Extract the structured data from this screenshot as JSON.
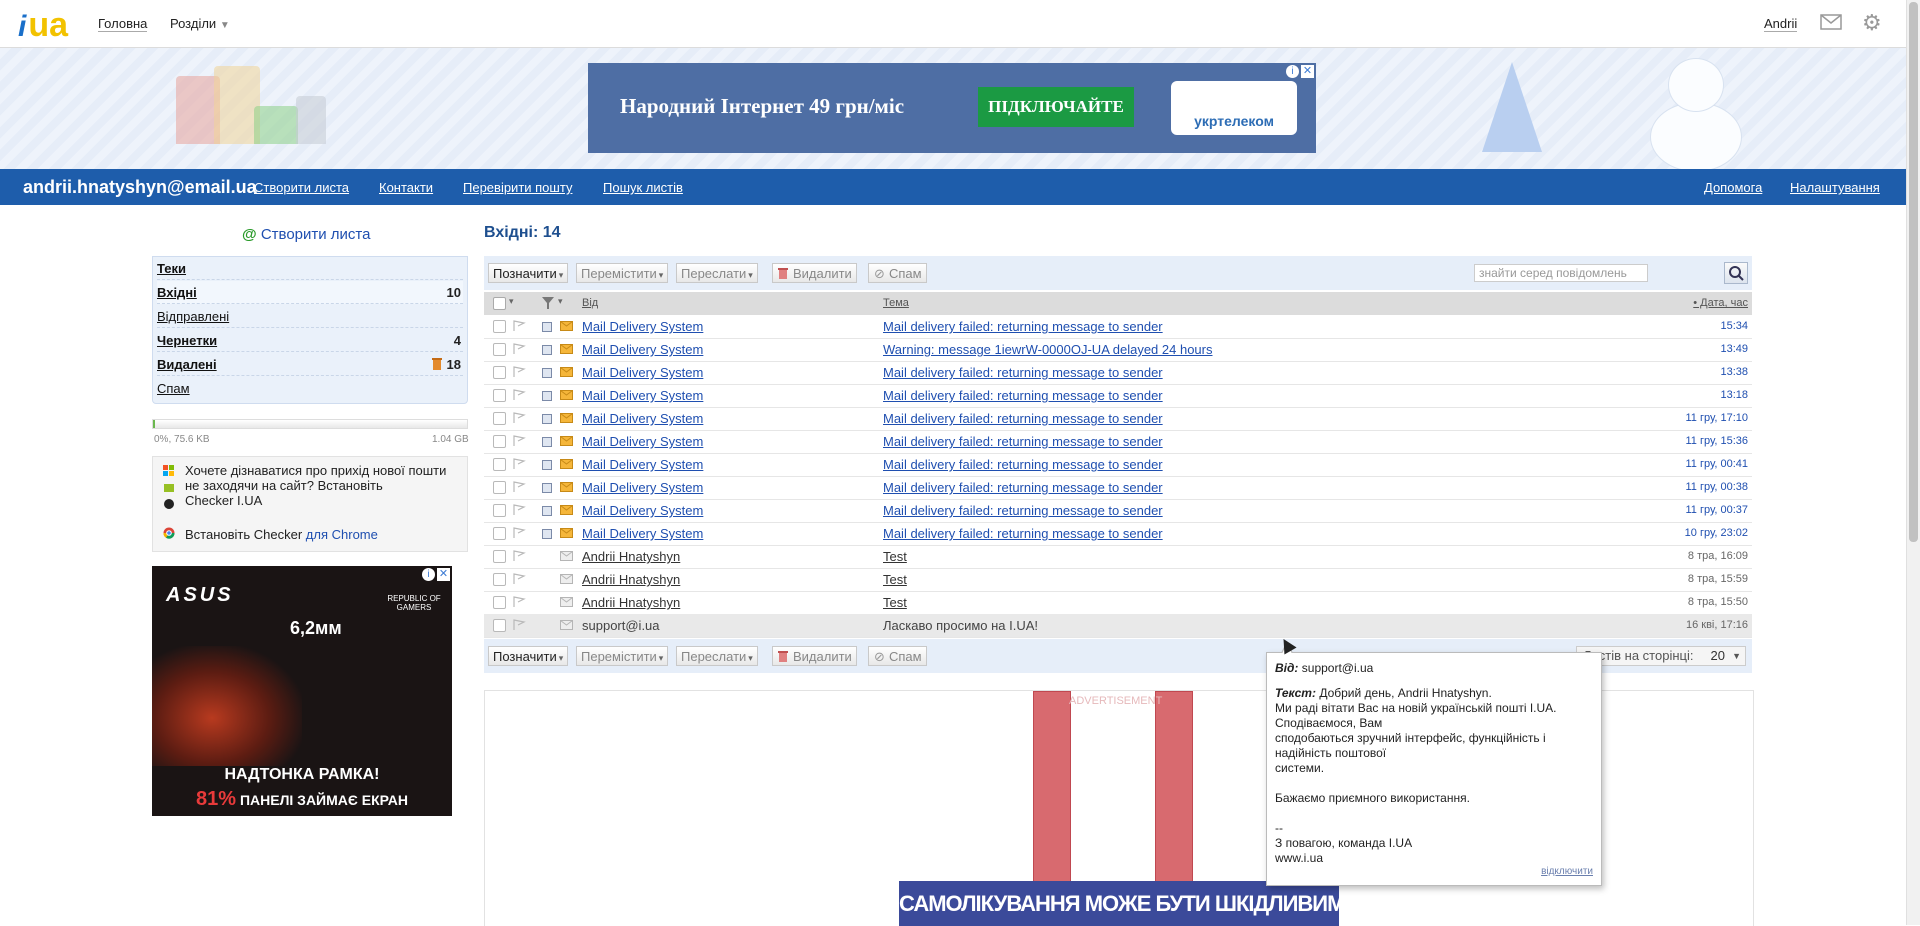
{
  "top": {
    "logo_i": "i",
    "logo_ua": "ua",
    "nav_home": "Головна",
    "nav_sections": "Розділи",
    "caret": "▼",
    "user": "Andrii"
  },
  "banner_ad": {
    "text": "Народний Інтернет 49 грн/міс",
    "button": "ПІДКЛЮЧАЙТЕ",
    "brand": "укртелеком",
    "close": "✕",
    "info": "i"
  },
  "bluebar": {
    "email": "andrii.hnatyshyn@email.ua",
    "links": [
      "Створити листа",
      "Контакти",
      "Перевірити пошту",
      "Пошук листів"
    ],
    "help": "Допомога",
    "settings": "Налаштування"
  },
  "sidebar": {
    "create_at": "@",
    "create_label": "Створити листа",
    "folders": [
      {
        "label": "Теки",
        "count": ""
      },
      {
        "label": "Вхідні",
        "count": "10"
      },
      {
        "label": "Відправлені",
        "count": ""
      },
      {
        "label": "Чернетки",
        "count": "4"
      },
      {
        "label": "Видалені",
        "count": "18"
      },
      {
        "label": "Спам",
        "count": ""
      }
    ],
    "quota_left": "0%, 75.6 KB",
    "quota_right": "1.04 GB",
    "quota_fraction": 0.0,
    "checker_text1": "Хочете дізнаватися про прихід нової пошти",
    "checker_text2": "не заходячи на сайт? Встановіть",
    "checker_link": "Checker I.UA",
    "chrome_text": "Встановіть Checker",
    "chrome_link": "для Chrome"
  },
  "side_ad": {
    "brand": "ASUS",
    "rog": "REPUBLIC OF GAMERS",
    "thickness": "6,2мм",
    "line1": "НАДТОНКА РАМКА!",
    "pct": "81%",
    "line2": "ПАНЕЛІ ЗАЙМАЄ ЕКРАН",
    "close": "✕",
    "info": "i"
  },
  "main": {
    "title": "Вхідні: 14",
    "toolbar": {
      "mark": "Позначити",
      "move": "Перемістити",
      "forward": "Переслати",
      "delete": "Видалити",
      "spam": "Спам",
      "dd": "▾"
    },
    "search_placeholder": "знайти серед повідомлень",
    "headers": {
      "from": "Від",
      "subject": "Тема",
      "date": "• Дата, час"
    },
    "rows": [
      {
        "from": "Mail Delivery System",
        "subject": "Mail delivery failed: returning message to sender",
        "date": "15:34"
      },
      {
        "from": "Mail Delivery System",
        "subject": "Warning: message 1iewrW-0000OJ-UA delayed 24 hours",
        "date": "13:49"
      },
      {
        "from": "Mail Delivery System",
        "subject": "Mail delivery failed: returning message to sender",
        "date": "13:38"
      },
      {
        "from": "Mail Delivery System",
        "subject": "Mail delivery failed: returning message to sender",
        "date": "13:18"
      },
      {
        "from": "Mail Delivery System",
        "subject": "Mail delivery failed: returning message to sender",
        "date": "11 гру, 17:10"
      },
      {
        "from": "Mail Delivery System",
        "subject": "Mail delivery failed: returning message to sender",
        "date": "11 гру, 15:36"
      },
      {
        "from": "Mail Delivery System",
        "subject": "Mail delivery failed: returning message to sender",
        "date": "11 гру, 00:41"
      },
      {
        "from": "Mail Delivery System",
        "subject": "Mail delivery failed: returning message to sender",
        "date": "11 гру, 00:38"
      },
      {
        "from": "Mail Delivery System",
        "subject": "Mail delivery failed: returning message to sender",
        "date": "11 гру, 00:37"
      },
      {
        "from": "Mail Delivery System",
        "subject": "Mail delivery failed: returning message to sender",
        "date": "10 гру, 23:02"
      },
      {
        "from": "Andrii Hnatyshyn",
        "subject": "Test",
        "date": "8 тра, 16:09"
      },
      {
        "from": "Andrii Hnatyshyn",
        "subject": "Test",
        "date": "8 тра, 15:59"
      },
      {
        "from": "Andrii Hnatyshyn",
        "subject": "Test",
        "date": "8 тра, 15:50"
      },
      {
        "from": "support@i.ua",
        "subject": "Ласкаво просимо на I.UA!",
        "date": "16 кві, 17:16"
      }
    ],
    "per_page_label": "Листів на сторінці:",
    "per_page_value": "20",
    "per_page_caret": "▼"
  },
  "bottom_ad": {
    "label": "ADVERTISEMENT",
    "warning": "САМОЛІКУВАННЯ МОЖЕ БУТИ ШКІДЛИВИМ ДЛЯ ВАШОГО ЗДОРОВ'Я"
  },
  "tooltip": {
    "from_label": "Від:",
    "from_value": "support@i.ua",
    "text_label": "Текст:",
    "lines": [
      "Добрий день, Andrii Hnatyshyn.",
      "Ми раді вітати Вас на новій українській пошті I.UA.",
      "Сподіваємося, Вам",
      "сподобаються зручний інтерфейс, функційність і",
      "надійність поштової",
      "системи.",
      "",
      "Бажаємо приємного використання.",
      "",
      "--",
      "З повагою, команда I.UA",
      "www.i.ua"
    ],
    "disable": "відключити"
  }
}
